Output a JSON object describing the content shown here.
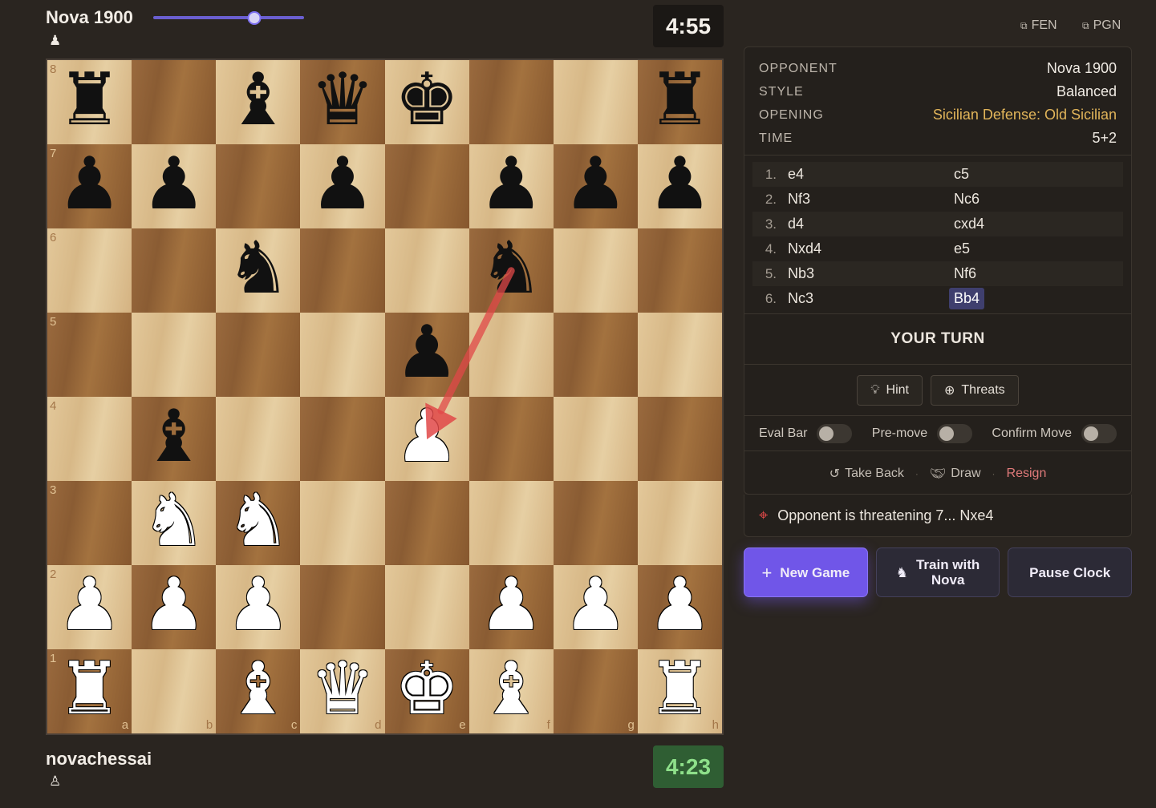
{
  "top_player": {
    "name": "Nova 1900",
    "icon": "pawn-icon",
    "clock": "4:55",
    "slider_value": 0.67
  },
  "bottom_player": {
    "name": "novachessai",
    "icon": "pawn-outline-icon",
    "clock": "4:23"
  },
  "board": {
    "rows": [
      [
        "br",
        "",
        "bb",
        "bq",
        "bk",
        "",
        "",
        "br"
      ],
      [
        "bp",
        "bp",
        "",
        "bp",
        "",
        "bp",
        "bp",
        "bp"
      ],
      [
        "",
        "",
        "bn",
        "",
        "",
        "bn",
        "",
        ""
      ],
      [
        "",
        "",
        "",
        "",
        "bp",
        "",
        "",
        ""
      ],
      [
        "",
        "bb",
        "",
        "",
        "wp",
        "",
        "",
        ""
      ],
      [
        "",
        "wn",
        "wn",
        "",
        "",
        "",
        "",
        ""
      ],
      [
        "wp",
        "wp",
        "wp",
        "",
        "",
        "wp",
        "wp",
        "wp"
      ],
      [
        "wr",
        "",
        "wb",
        "wq",
        "wk",
        "wb",
        "",
        "wr"
      ]
    ],
    "ranks": [
      "8",
      "7",
      "6",
      "5",
      "4",
      "3",
      "2",
      "1"
    ],
    "files": [
      "a",
      "b",
      "c",
      "d",
      "e",
      "f",
      "g",
      "h"
    ],
    "arrow": {
      "from": "f6",
      "to": "e4",
      "color": "#e04848"
    }
  },
  "export": {
    "fen_label": "FEN",
    "pgn_label": "PGN"
  },
  "info": [
    {
      "key": "OPPONENT",
      "value": "Nova 1900"
    },
    {
      "key": "STYLE",
      "value": "Balanced"
    },
    {
      "key": "OPENING",
      "value": "Sicilian Defense: Old Sicilian",
      "highlight": true
    },
    {
      "key": "TIME",
      "value": "5+2"
    }
  ],
  "moves": [
    {
      "num": "1.",
      "white": "e4",
      "black": "c5"
    },
    {
      "num": "2.",
      "white": "Nf3",
      "black": "Nc6"
    },
    {
      "num": "3.",
      "white": "d4",
      "black": "cxd4"
    },
    {
      "num": "4.",
      "white": "Nxd4",
      "black": "e5"
    },
    {
      "num": "5.",
      "white": "Nb3",
      "black": "Nf6"
    },
    {
      "num": "6.",
      "white": "Nc3",
      "black": "Bb4",
      "current": true
    }
  ],
  "turn_label": "YOUR TURN",
  "tools": {
    "hint": "Hint",
    "threats": "Threats"
  },
  "toggles": {
    "eval_bar": "Eval Bar",
    "premove": "Pre-move",
    "confirm_move": "Confirm Move"
  },
  "actions": {
    "take_back": "Take Back",
    "draw": "Draw",
    "resign": "Resign"
  },
  "threat_message": "Opponent is threatening 7... Nxe4",
  "buttons": {
    "new_game": "New Game",
    "train_line1": "Train with",
    "train_line2": "Nova",
    "pause_clock": "Pause Clock"
  },
  "colors": {
    "accent": "#7056e8",
    "opening": "#e2b55a",
    "danger": "#e07a7a",
    "clock_active": "#8ee08a"
  }
}
